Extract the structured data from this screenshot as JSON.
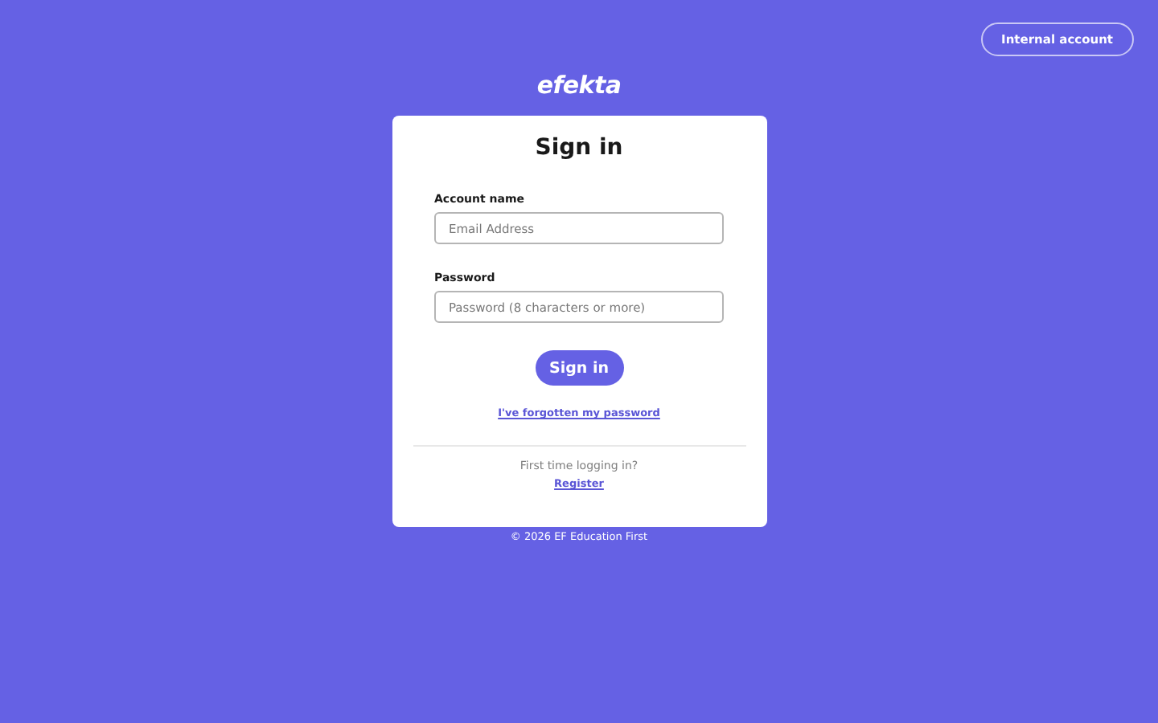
{
  "header": {
    "internal_account_button": "Internal account",
    "logo": "efekta"
  },
  "card": {
    "title": "Sign in",
    "fields": [
      {
        "label": "Account name",
        "placeholder": "Email Address"
      },
      {
        "label": "Password",
        "placeholder": "Password (8 characters or more)"
      }
    ],
    "submit_button": "Sign in",
    "forgot_link": "I've forgotten my password",
    "first_time_text": "First time logging in?",
    "register_link": "Register"
  },
  "footer": {
    "copyright": "© 2026 EF Education First"
  }
}
